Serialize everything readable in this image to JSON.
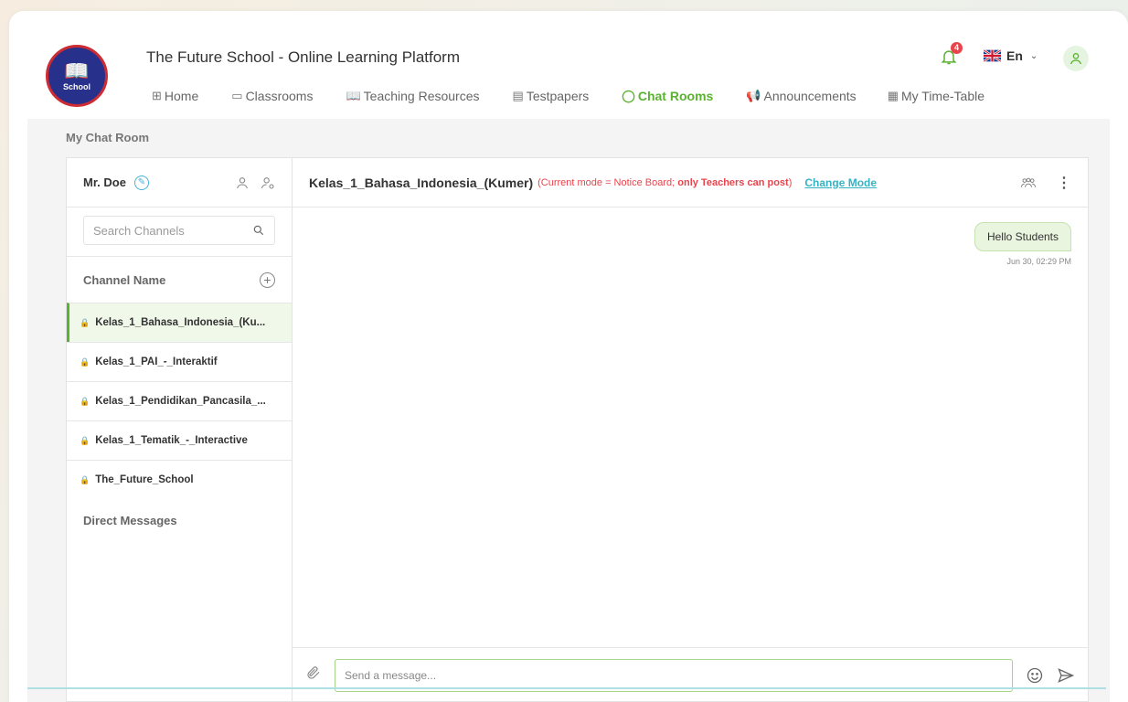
{
  "header": {
    "logo_text": "School",
    "title": "The Future School - Online Learning Platform",
    "notifications_count": "4",
    "language": "En"
  },
  "nav": [
    {
      "label": "Home",
      "icon": "grid-icon"
    },
    {
      "label": "Classrooms",
      "icon": "monitor-icon"
    },
    {
      "label": "Teaching Resources",
      "icon": "book-icon"
    },
    {
      "label": "Testpapers",
      "icon": "document-edit-icon"
    },
    {
      "label": "Chat Rooms",
      "icon": "chat-icon"
    },
    {
      "label": "Announcements",
      "icon": "megaphone-icon"
    },
    {
      "label": "My Time-Table",
      "icon": "calendar-icon"
    }
  ],
  "section_title": "My Chat Room",
  "sidebar": {
    "user_name": "Mr. Doe",
    "search_placeholder": "Search Channels",
    "channels_header": "Channel Name",
    "channels": [
      {
        "name": "Kelas_1_Bahasa_Indonesia_(Ku..."
      },
      {
        "name": "Kelas_1_PAI_-_Interaktif"
      },
      {
        "name": "Kelas_1_Pendidikan_Pancasila_..."
      },
      {
        "name": "Kelas_1_Tematik_-_Interactive"
      },
      {
        "name": "The_Future_School"
      }
    ],
    "direct_messages_header": "Direct Messages"
  },
  "chat": {
    "channel_title": "Kelas_1_Bahasa_Indonesia_(Kumer)",
    "mode_prefix": "(Current mode = Notice Board; ",
    "mode_emphasis": "only Teachers can post",
    "mode_suffix": ")",
    "change_mode_label": "Change Mode",
    "messages": [
      {
        "text": "Hello Students",
        "time": "Jun 30, 02:29 PM"
      }
    ],
    "input_placeholder": "Send a message..."
  },
  "colors": {
    "accent_green": "#5bb230",
    "alert_red": "#e8444c",
    "link_teal": "#35b3c4",
    "logo_navy": "#27308a"
  }
}
